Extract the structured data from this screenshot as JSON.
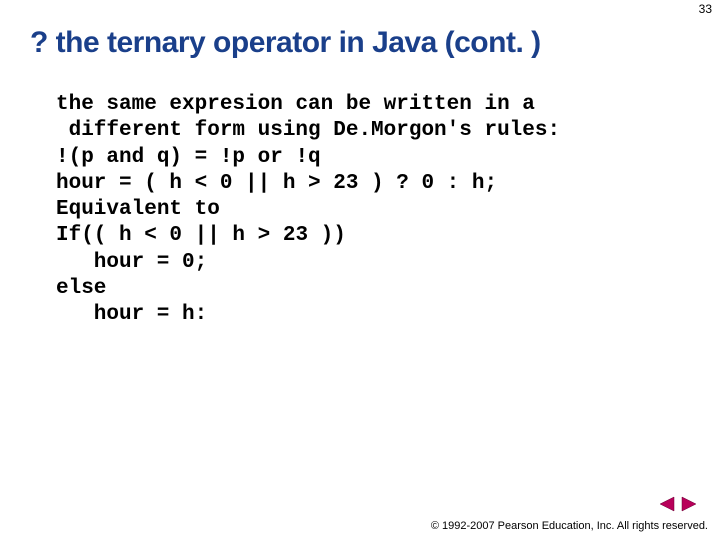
{
  "page_number": "33",
  "title": "? the ternary operator in Java (cont. )",
  "code": {
    "l1": "the same expresion can be written in a",
    "l2": "different form using De.Morgon's rules:",
    "l3": "!(p and q) = !p or !q",
    "l4": "hour =  ( h < 0 || h > 23 ) ? 0 : h;",
    "l5": "Equivalent to",
    "l6": "If(( h < 0 ||  h > 23 ))",
    "l7": "hour = 0;",
    "l8": "else",
    "l9": "hour = h:"
  },
  "footer": {
    "copyright": "1992-2007 Pearson Education, Inc. All rights reserved."
  },
  "icons": {
    "prev": "prev-slide",
    "next": "next-slide"
  }
}
